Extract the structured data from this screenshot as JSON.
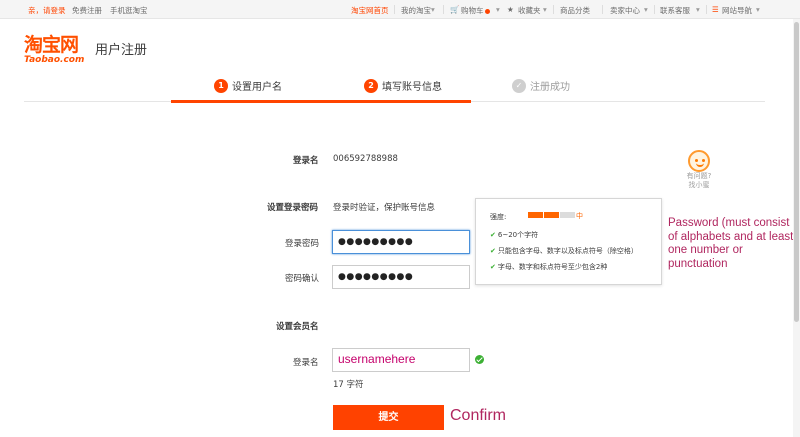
{
  "topbar": {
    "login_prompt": "亲，请登录",
    "register": "免费注册",
    "mobile": "手机逛淘宝",
    "home": "淘宝网首页",
    "my_taobao": "我的淘宝",
    "cart": "购物车",
    "favorites": "收藏夹",
    "categories": "商品分类",
    "seller": "卖家中心",
    "service": "联系客服",
    "site_nav": "网站导航"
  },
  "header": {
    "logo_cn": "淘宝网",
    "logo_en": "Taobao.com",
    "page_title": "用户注册"
  },
  "steps": [
    {
      "num": "1",
      "label": "设置用户名",
      "state": "active"
    },
    {
      "num": "2",
      "label": "填写账号信息",
      "state": "active"
    },
    {
      "num": "✓",
      "label": "注册成功",
      "state": "pending"
    }
  ],
  "form": {
    "login_name_label": "登录名",
    "login_name_value": "006592788988",
    "password_section_label": "设置登录密码",
    "password_section_hint": "登录时验证，保护账号信息",
    "password_label": "登录密码",
    "password_value": "●●●●●●●●●",
    "confirm_label": "密码确认",
    "confirm_value": "●●●●●●●●●",
    "member_section_label": "设置会员名",
    "member_label": "登录名",
    "member_value": "usernamehere",
    "char_count": "17 字符",
    "submit_label": "提交"
  },
  "tooltip": {
    "strength_label": "强度:",
    "strength_value": "中",
    "strength_level": 0.66,
    "rules": [
      "6~20个字符",
      "只能包含字母、数字以及标点符号（除空格）",
      "字母、数字和标点符号至少包含2种"
    ]
  },
  "help": {
    "line1": "有问题?",
    "line2": "找小蜜"
  },
  "annotations": {
    "password_note": "Password (must consist of alphabets and at least one number or punctuation",
    "confirm_note": "Confirm"
  },
  "colors": {
    "brand": "#ff4400",
    "annotation": "#b0265f",
    "success": "#3cb034",
    "focus": "#4a90d9"
  }
}
